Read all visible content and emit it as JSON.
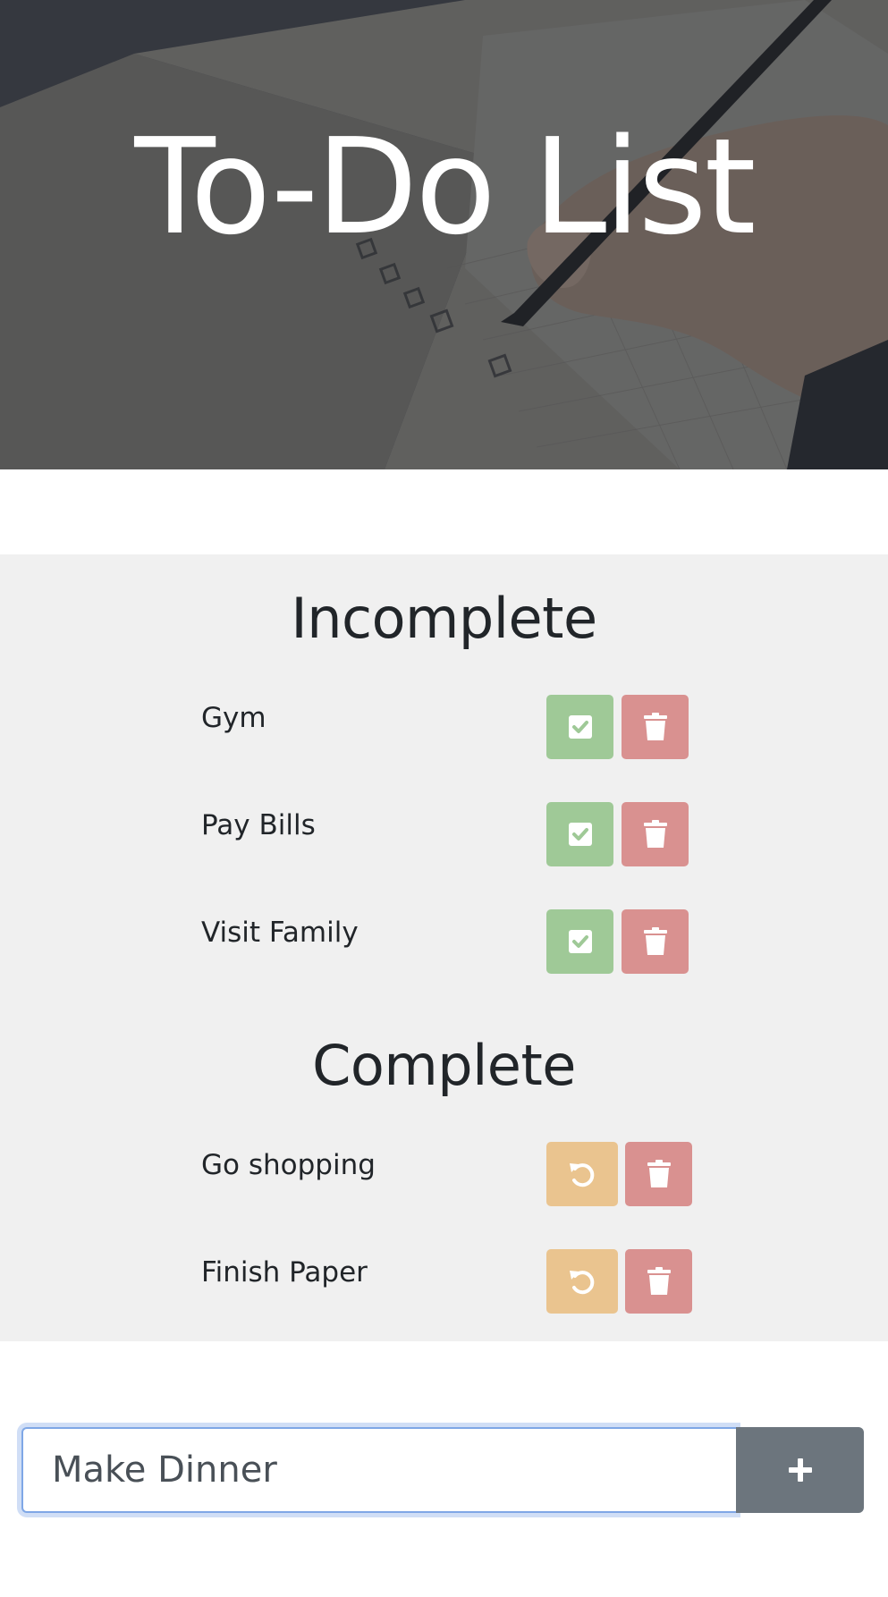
{
  "header": {
    "title": "To-Do List"
  },
  "incomplete": {
    "heading": "Incomplete",
    "items": [
      {
        "label": "Gym"
      },
      {
        "label": "Pay Bills"
      },
      {
        "label": "Visit Family"
      }
    ]
  },
  "complete": {
    "heading": "Complete",
    "items": [
      {
        "label": "Go shopping"
      },
      {
        "label": "Finish Paper"
      }
    ]
  },
  "add_task": {
    "value": "Make Dinner",
    "button_icon": "plus-icon"
  },
  "icons": {
    "complete": "check-square-icon",
    "delete": "trash-icon",
    "undo": "undo-icon"
  },
  "colors": {
    "complete_button": "#9fc997",
    "delete_button": "#d99190",
    "undo_button": "#eac48f",
    "add_button": "#6c757d",
    "section_background": "#f0f0f0"
  }
}
